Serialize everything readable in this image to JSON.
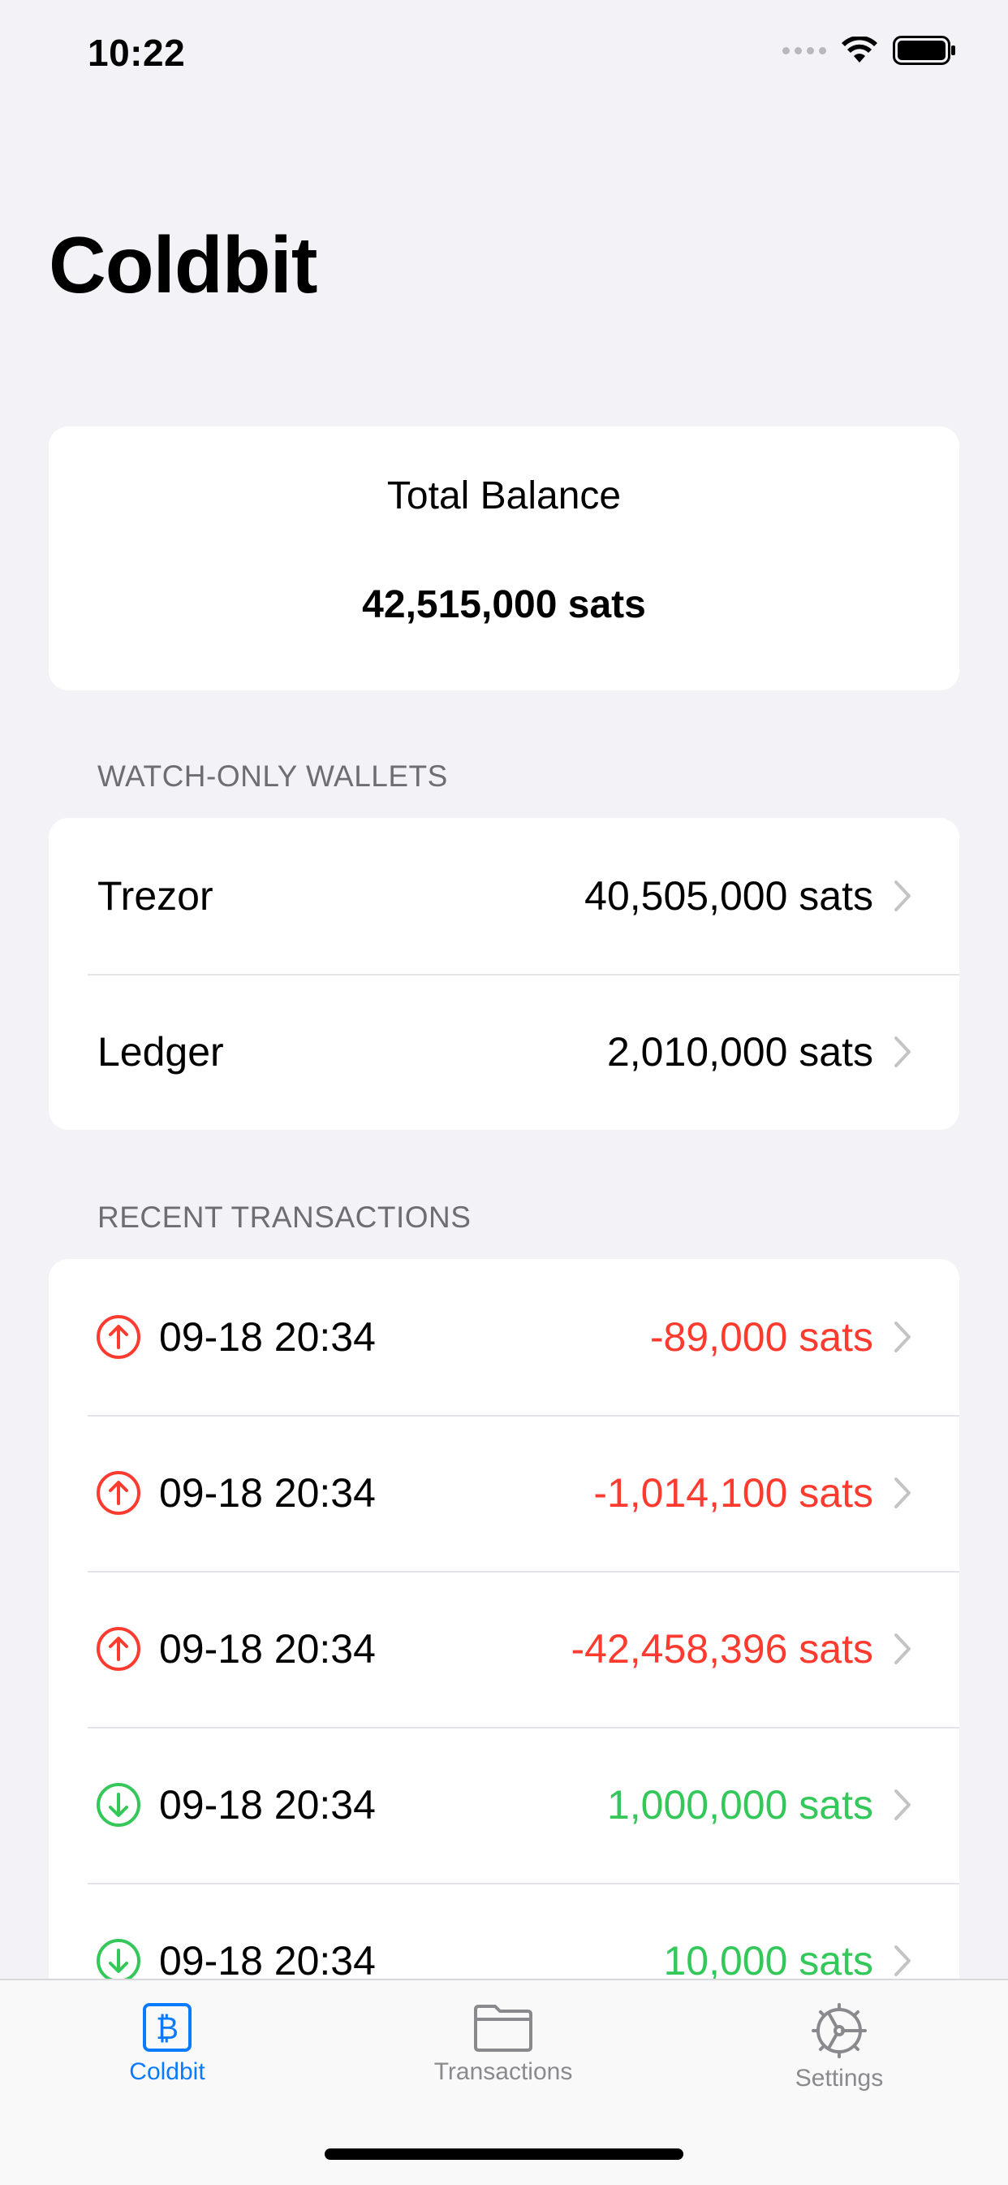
{
  "status_bar": {
    "time": "10:22"
  },
  "app_title": "Coldbit",
  "balance": {
    "title": "Total Balance",
    "value": "42,515,000 sats"
  },
  "wallets": {
    "header": "WATCH-ONLY WALLETS",
    "items": [
      {
        "name": "Trezor",
        "balance": "40,505,000 sats"
      },
      {
        "name": "Ledger",
        "balance": "2,010,000 sats"
      }
    ]
  },
  "transactions": {
    "header": "RECENT TRANSACTIONS",
    "items": [
      {
        "date": "09-18 20:34",
        "amount": "-89,000 sats",
        "direction": "outgoing",
        "icon": "arrow-up-circle-icon"
      },
      {
        "date": "09-18 20:34",
        "amount": "-1,014,100 sats",
        "direction": "outgoing",
        "icon": "arrow-up-circle-icon"
      },
      {
        "date": "09-18 20:34",
        "amount": "-42,458,396 sats",
        "direction": "outgoing",
        "icon": "arrow-up-circle-icon"
      },
      {
        "date": "09-18 20:34",
        "amount": "1,000,000 sats",
        "direction": "incoming",
        "icon": "arrow-down-circle-icon"
      },
      {
        "date": "09-18 20:34",
        "amount": "10,000 sats",
        "direction": "incoming",
        "icon": "arrow-down-circle-icon"
      }
    ]
  },
  "tab_bar": {
    "tabs": [
      {
        "label": "Coldbit",
        "icon": "bitcoin-icon",
        "active": true
      },
      {
        "label": "Transactions",
        "icon": "folder-icon",
        "active": false
      },
      {
        "label": "Settings",
        "icon": "gear-icon",
        "active": false
      }
    ]
  },
  "colors": {
    "accent": "#0a7aff",
    "negative": "#ff3b30",
    "positive": "#34c759",
    "background": "#f2f2f7"
  }
}
